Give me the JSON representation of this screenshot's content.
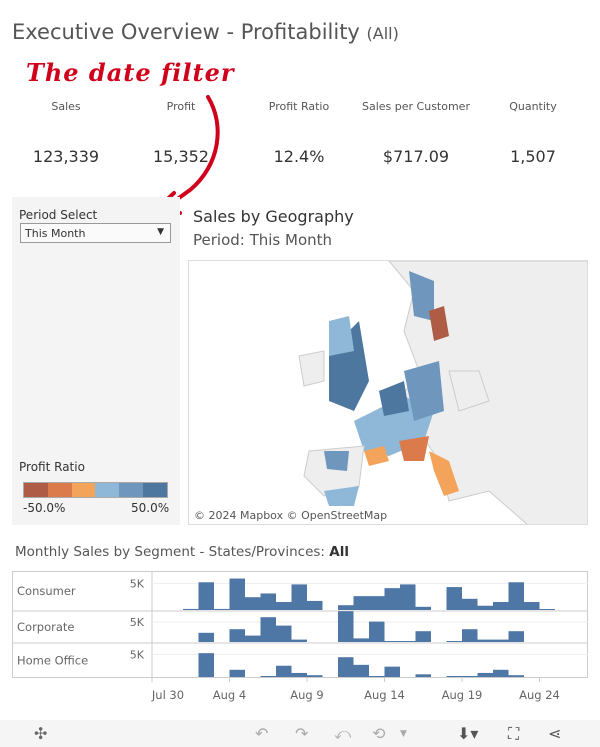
{
  "header": {
    "title": "Executive Overview - Profitability",
    "filter_scope": "(All)"
  },
  "annotation": {
    "text": "The date filter",
    "color": "#d0021b"
  },
  "kpis": [
    {
      "label": "Sales",
      "value": "123,339"
    },
    {
      "label": "Profit",
      "value": "15,352"
    },
    {
      "label": "Profit Ratio",
      "value": "12.4%"
    },
    {
      "label": "Sales per Customer",
      "value": "$717.09"
    },
    {
      "label": "Quantity",
      "value": "1,507"
    }
  ],
  "filters": {
    "period_label": "Period Select",
    "period_value": "This Month"
  },
  "legend": {
    "title": "Profit Ratio",
    "min": "-50.0%",
    "max": "50.0%",
    "colors": [
      "#ae5c45",
      "#db7a4a",
      "#f4a45a",
      "#8fb8d8",
      "#6f96bc",
      "#4e77a0"
    ]
  },
  "map": {
    "title": "Sales by Geography",
    "subtitle": "Period: This Month",
    "credit": "© 2024 Mapbox  © OpenStreetMap"
  },
  "chart": {
    "title_prefix": "Monthly Sales by Segment - States/Provinces: ",
    "title_value": "All"
  },
  "chart_data": {
    "type": "bar",
    "x_start": "Jul 30",
    "x_end": "Aug 26",
    "x_ticks": [
      "Jul 30",
      "Aug 4",
      "Aug 9",
      "Aug 14",
      "Aug 19",
      "Aug 24"
    ],
    "y_tick": "5K",
    "bar_color": "#4e77a6",
    "days": [
      "Aug 1",
      "Aug 2",
      "Aug 3",
      "Aug 4",
      "Aug 5",
      "Aug 6",
      "Aug 7",
      "Aug 8",
      "Aug 9",
      "Aug 10",
      "Aug 11",
      "Aug 12",
      "Aug 13",
      "Aug 14",
      "Aug 15",
      "Aug 16",
      "Aug 17",
      "Aug 18",
      "Aug 19",
      "Aug 20",
      "Aug 21",
      "Aug 22",
      "Aug 23",
      "Aug 24"
    ],
    "series": [
      {
        "name": "Consumer",
        "values": [
          200,
          5200,
          200,
          5900,
          2400,
          3100,
          1500,
          4800,
          1700,
          0,
          900,
          2600,
          2600,
          4100,
          4800,
          600,
          0,
          4300,
          2100,
          800,
          1500,
          5200,
          1500,
          150
        ]
      },
      {
        "name": "Corporate",
        "values": [
          0,
          2300,
          0,
          3200,
          1600,
          6200,
          4100,
          600,
          0,
          0,
          7700,
          900,
          5100,
          200,
          200,
          2700,
          0,
          200,
          3200,
          600,
          600,
          2700,
          0,
          0
        ]
      },
      {
        "name": "Home Office",
        "values": [
          0,
          5300,
          0,
          1600,
          0,
          200,
          2500,
          900,
          400,
          0,
          4400,
          2700,
          200,
          2300,
          0,
          600,
          0,
          200,
          200,
          900,
          1600,
          400,
          0,
          0
        ]
      }
    ]
  },
  "toolbar": {
    "icons": [
      "tableau-logo-icon",
      "undo-icon",
      "redo-icon",
      "revert-icon",
      "refresh-icon",
      "download-icon",
      "fullscreen-icon",
      "share-icon"
    ]
  }
}
